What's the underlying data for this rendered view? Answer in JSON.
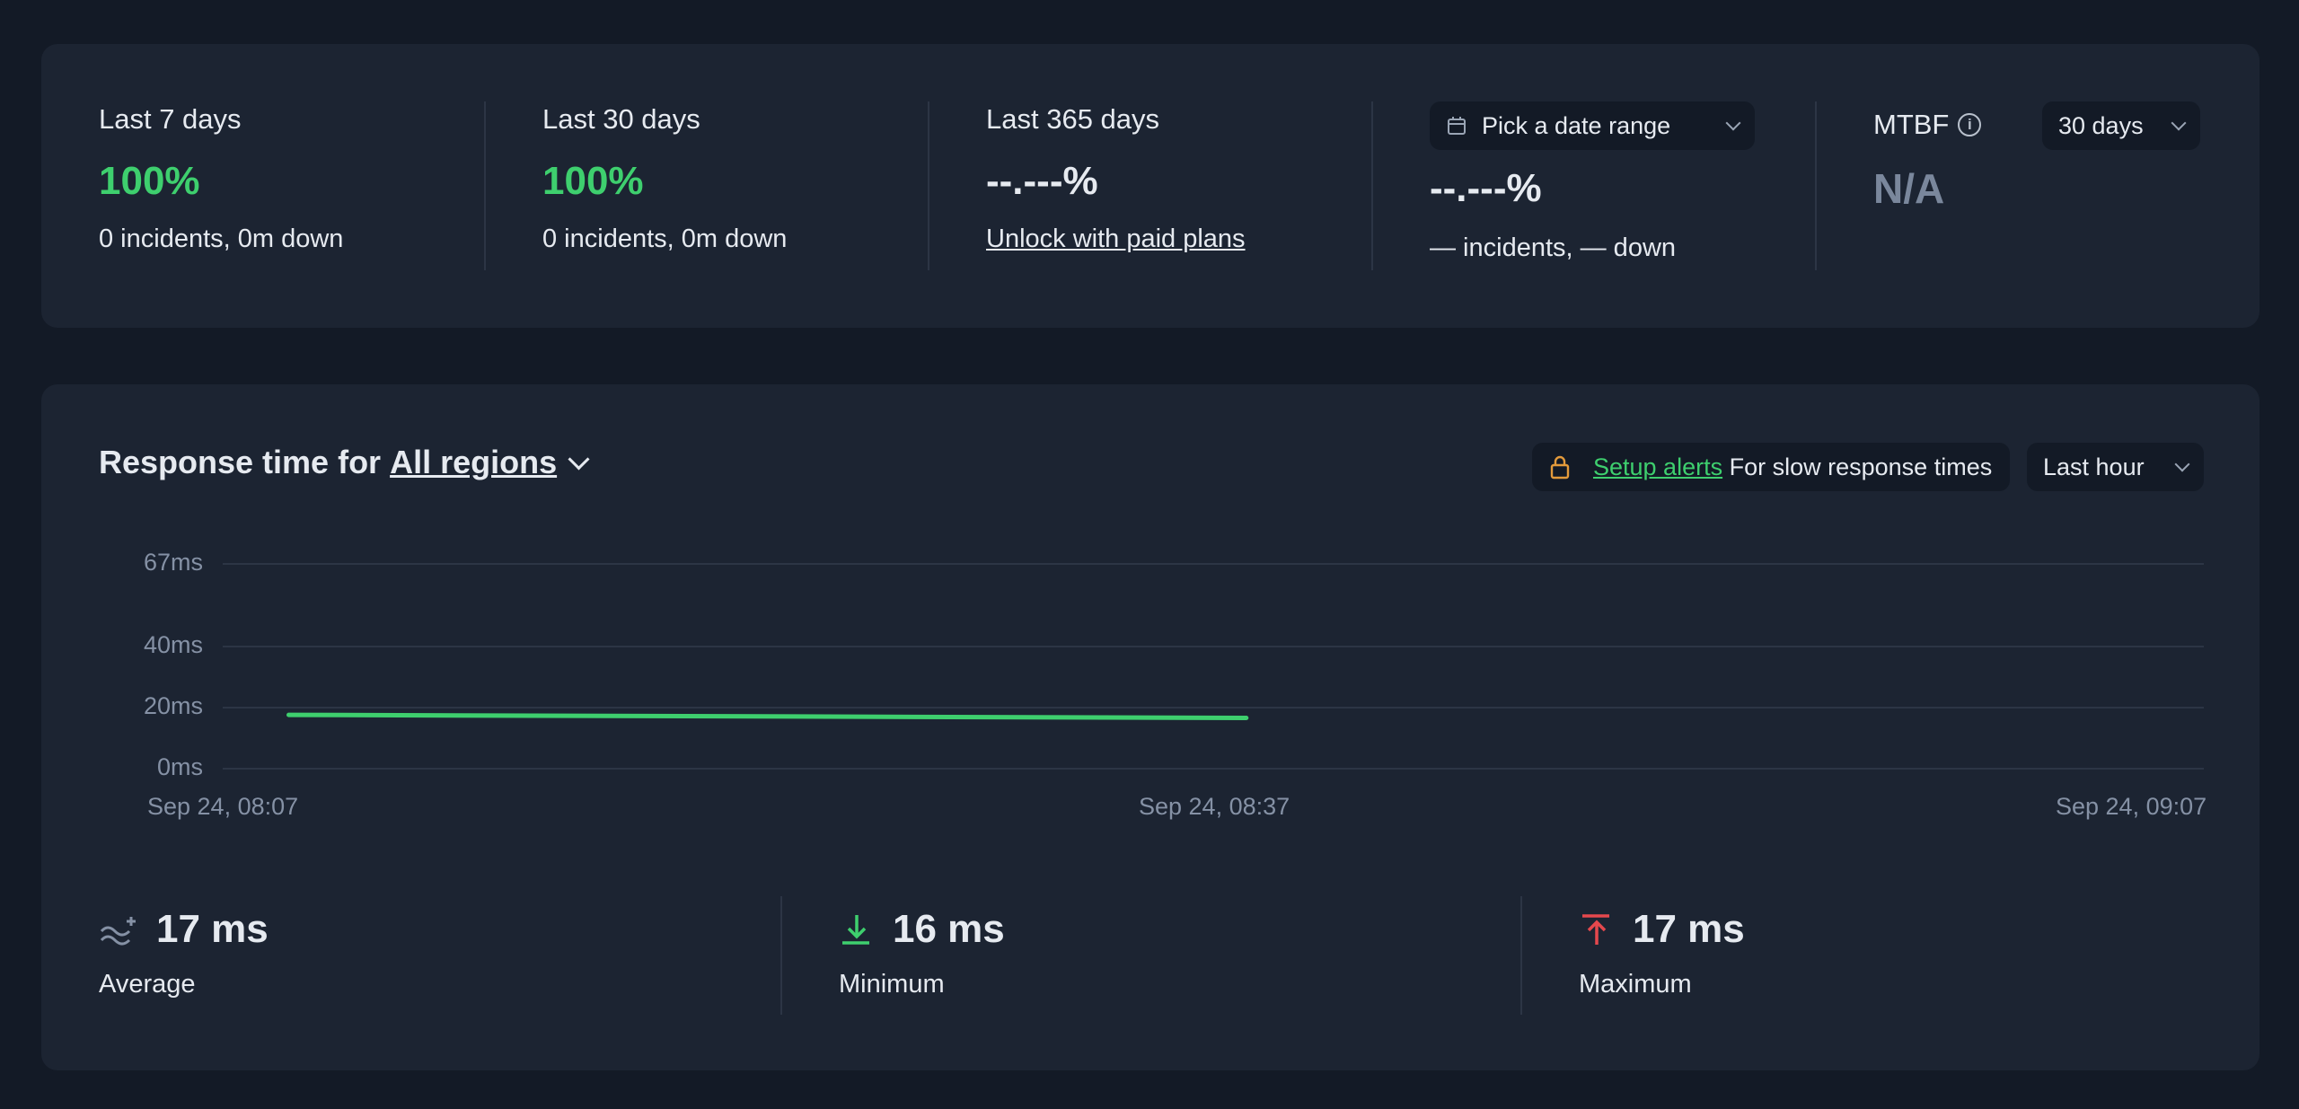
{
  "uptime": {
    "last7": {
      "label": "Last 7 days",
      "percent": "100%",
      "summary": "0 incidents, 0m down"
    },
    "last30": {
      "label": "Last 30 days",
      "percent": "100%",
      "summary": "0 incidents, 0m down"
    },
    "last365": {
      "label": "Last 365 days",
      "percent": "--.---%",
      "link": "Unlock with paid plans"
    },
    "custom": {
      "picker_label": "Pick a date range",
      "percent": "--.---%",
      "summary": "— incidents, — down"
    },
    "mtbf": {
      "label": "MTBF",
      "value": "N/A",
      "period": "30 days"
    }
  },
  "response": {
    "title_prefix": "Response time for",
    "region": "All regions",
    "alerts_link": "Setup alerts",
    "alerts_text": "For slow response times",
    "period": "Last hour"
  },
  "chart_data": {
    "type": "line",
    "y_ticks": [
      "67ms",
      "40ms",
      "20ms",
      "0ms"
    ],
    "x_ticks": [
      "Sep 24, 08:07",
      "Sep 24, 08:37",
      "Sep 24, 09:07"
    ],
    "ylim": [
      0,
      67
    ],
    "series": [
      {
        "x": [
          "08:09",
          "08:38"
        ],
        "y": [
          17.3,
          16.3
        ],
        "color": "#3ecf6e"
      }
    ],
    "grid": true
  },
  "metrics": {
    "average": {
      "value": "17 ms",
      "label": "Average"
    },
    "minimum": {
      "value": "16 ms",
      "label": "Minimum"
    },
    "maximum": {
      "value": "17 ms",
      "label": "Maximum"
    }
  },
  "colors": {
    "accent_green": "#3ecf6e",
    "lock_orange": "#e39a3b",
    "max_red": "#e5484d",
    "muted": "#7a879c"
  }
}
